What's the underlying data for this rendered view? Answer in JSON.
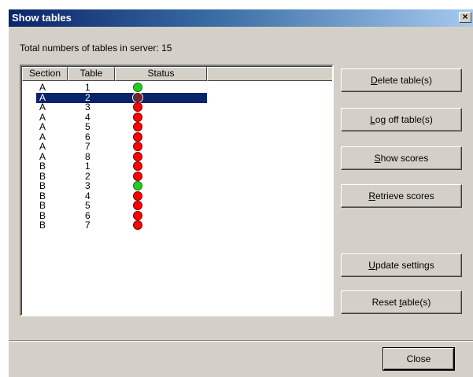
{
  "window": {
    "title": "Show tables",
    "close_glyph": "×",
    "titlebar_color": "#0a246a"
  },
  "summary": {
    "label": "Total numbers of tables in server: 15"
  },
  "table": {
    "columns": [
      "Section",
      "Table",
      "Status",
      ""
    ],
    "status_colors": {
      "green": "#22cc22",
      "red": "#ff0000",
      "selected": "#6b2a3a"
    },
    "selected_index": 1,
    "rows": [
      {
        "section": "A",
        "table": "1",
        "status": "green"
      },
      {
        "section": "A",
        "table": "2",
        "status": "red"
      },
      {
        "section": "A",
        "table": "3",
        "status": "red"
      },
      {
        "section": "A",
        "table": "4",
        "status": "red"
      },
      {
        "section": "A",
        "table": "5",
        "status": "red"
      },
      {
        "section": "A",
        "table": "6",
        "status": "red"
      },
      {
        "section": "A",
        "table": "7",
        "status": "red"
      },
      {
        "section": "A",
        "table": "8",
        "status": "red"
      },
      {
        "section": "B",
        "table": "1",
        "status": "red"
      },
      {
        "section": "B",
        "table": "2",
        "status": "red"
      },
      {
        "section": "B",
        "table": "3",
        "status": "green"
      },
      {
        "section": "B",
        "table": "4",
        "status": "red"
      },
      {
        "section": "B",
        "table": "5",
        "status": "red"
      },
      {
        "section": "B",
        "table": "6",
        "status": "red"
      },
      {
        "section": "B",
        "table": "7",
        "status": "red"
      }
    ]
  },
  "buttons": {
    "delete": {
      "accel": "D",
      "rest": "elete table(s)"
    },
    "logoff": {
      "accel": "L",
      "rest": "og off table(s)"
    },
    "show_scores": {
      "accel": "S",
      "rest": "how scores"
    },
    "retrieve": {
      "accel": "R",
      "rest": "etrieve scores"
    },
    "update": {
      "accel": "U",
      "rest": "pdate settings"
    },
    "reset": {
      "pre": "Reset ",
      "accel": "t",
      "rest": "able(s)"
    },
    "close": "Close"
  }
}
